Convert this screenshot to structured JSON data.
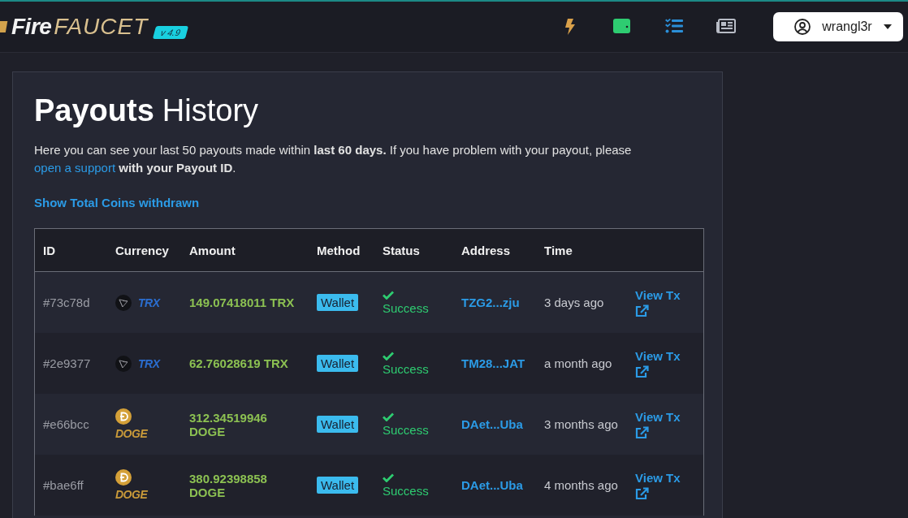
{
  "header": {
    "logo": {
      "first": "Fire",
      "second": "FAUCET",
      "version": "v 4.9"
    },
    "user": {
      "name": "wrangl3r"
    }
  },
  "page": {
    "title_bold": "Payouts",
    "title_rest": "History",
    "intro": "Here you can see your last 50 payouts made within **last 60 days.** If you have problem with your payout, please ",
    "intro_link": "open a support",
    "intro_end": " **with your Payout ID**.",
    "toggle_link": "Show Total Coins withdrawn"
  },
  "table": {
    "columns": [
      "ID",
      "Currency",
      "Amount",
      "Method",
      "Status",
      "Address",
      "Time"
    ],
    "rows": [
      {
        "id": "#73c78d",
        "currency": {
          "kind": "trx",
          "label": "TRX"
        },
        "amount": "149.07418011 TRX",
        "method": "Wallet",
        "status": "Success",
        "address": "TZG2...zju",
        "time": "3 days ago",
        "action": "View Tx"
      },
      {
        "id": "#2e9377",
        "currency": {
          "kind": "trx",
          "label": "TRX"
        },
        "amount": "62.76028619 TRX",
        "method": "Wallet",
        "status": "Success",
        "address": "TM28...JAT",
        "time": "a month ago",
        "action": "View Tx"
      },
      {
        "id": "#e66bcc",
        "currency": {
          "kind": "doge",
          "label": "DOGE"
        },
        "amount": "312.34519946 DOGE",
        "method": "Wallet",
        "status": "Success",
        "address": "DAet...Uba",
        "time": "3 months ago",
        "action": "View Tx"
      },
      {
        "id": "#bae6ff",
        "currency": {
          "kind": "doge",
          "label": "DOGE"
        },
        "amount": "380.92398858 DOGE",
        "method": "Wallet",
        "status": "Success",
        "address": "DAet...Uba",
        "time": "4 months ago",
        "action": "View Tx"
      }
    ]
  }
}
